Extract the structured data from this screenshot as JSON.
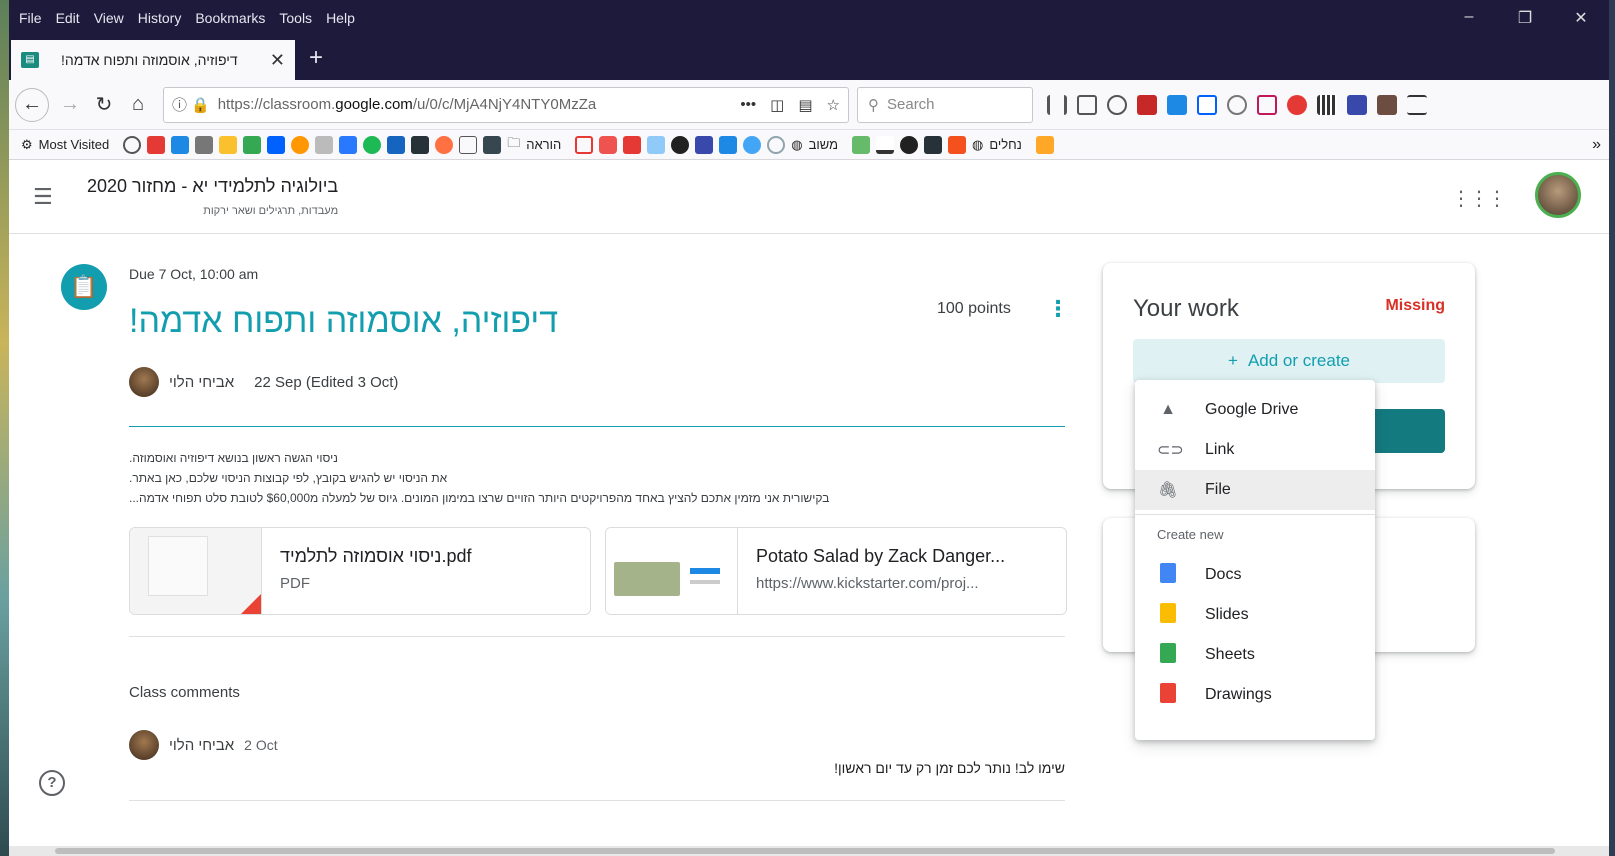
{
  "menubar": {
    "items": [
      "File",
      "Edit",
      "View",
      "History",
      "Bookmarks",
      "Tools",
      "Help"
    ]
  },
  "window_controls": {
    "minimize": "–",
    "restore": "❐",
    "close": "✕"
  },
  "tab": {
    "title": "דיפוזיה, אוסמוזה ותפוח אדמה!",
    "close": "✕",
    "new_tab": "+"
  },
  "nav": {
    "back": "←",
    "forward": "→",
    "reload": "↻",
    "home": "⌂",
    "url_prefix": "https://classroom.",
    "url_domain": "google.com",
    "url_rest": "/u/0/c/MjA4NjY4NTY0MzZa",
    "more": "•••",
    "search_placeholder": "Search"
  },
  "bookmarks": {
    "most_visited": "Most Visited",
    "folder1": "הוראה",
    "folder2": "משוב",
    "folder3": "נחלים",
    "more": "»"
  },
  "course": {
    "title": "ביולוגיה לתלמידי יא - מחזור 2020",
    "subtitle": "מעבדות, תרגילים ושאר ירקות"
  },
  "assignment": {
    "due": "Due 7 Oct, 10:00 am",
    "title": "דיפוזיה, אוסמוזה ותפוח אדמה!",
    "points": "100 points",
    "author": "אביחי הלוי",
    "date": "22 Sep (Edited 3 Oct)",
    "description": [
      "ניסוי הגשה ראשון בנושא דיפוזיה ואוסמוזה.",
      "את הניסוי יש להגיש בקובץ, לפי קבוצות הניסוי שלכם, כאן באתר.",
      "בקישורית אני מזמין אתכם להציץ באחד מהפרויקטים היותר הזויים שרצו במימון המונים. גיוס של למעלה מ$60,000 לטובת סלט תפוחי אדמה..."
    ],
    "attachments": [
      {
        "name": "ניסוי אוסמוזה לתלמיד.pdf",
        "type": "PDF"
      },
      {
        "name": "Potato Salad by Zack Danger...",
        "type": "https://www.kickstarter.com/proj..."
      }
    ]
  },
  "comments": {
    "title": "Class comments",
    "items": [
      {
        "author": "אביחי הלוי",
        "date": "2 Oct",
        "text": "שימו לב! נותר לכם זמן רק עד יום ראשון!"
      }
    ]
  },
  "your_work": {
    "title": "Your work",
    "status": "Missing",
    "add_label": "Add or create",
    "add_icon": "+"
  },
  "add_menu": {
    "items": [
      {
        "label": "Google Drive",
        "icon": "drive-icon"
      },
      {
        "label": "Link",
        "icon": "link-icon"
      },
      {
        "label": "File",
        "icon": "paperclip-icon"
      }
    ],
    "create_header": "Create new",
    "create_items": [
      {
        "label": "Docs",
        "color": "#4285f4"
      },
      {
        "label": "Slides",
        "color": "#fbbc04"
      },
      {
        "label": "Sheets",
        "color": "#34a853"
      },
      {
        "label": "Drawings",
        "color": "#ea4335"
      }
    ]
  },
  "colors": {
    "accent": "#129eaf",
    "missing": "#d93025",
    "chrome_dark": "#1e1a3c"
  }
}
